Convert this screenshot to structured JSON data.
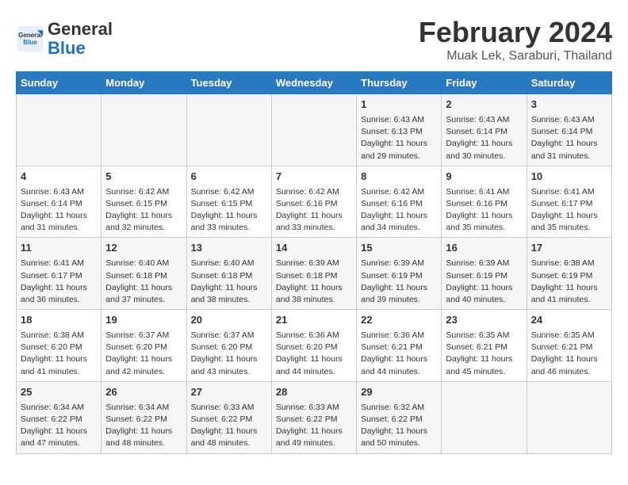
{
  "header": {
    "logo_line1": "General",
    "logo_line2": "Blue",
    "month_year": "February 2024",
    "location": "Muak Lek, Saraburi, Thailand"
  },
  "days_of_week": [
    "Sunday",
    "Monday",
    "Tuesday",
    "Wednesday",
    "Thursday",
    "Friday",
    "Saturday"
  ],
  "weeks": [
    [
      {
        "day": "",
        "info": ""
      },
      {
        "day": "",
        "info": ""
      },
      {
        "day": "",
        "info": ""
      },
      {
        "day": "",
        "info": ""
      },
      {
        "day": "1",
        "info": "Sunrise: 6:43 AM\nSunset: 6:13 PM\nDaylight: 11 hours\nand 29 minutes."
      },
      {
        "day": "2",
        "info": "Sunrise: 6:43 AM\nSunset: 6:14 PM\nDaylight: 11 hours\nand 30 minutes."
      },
      {
        "day": "3",
        "info": "Sunrise: 6:43 AM\nSunset: 6:14 PM\nDaylight: 11 hours\nand 31 minutes."
      }
    ],
    [
      {
        "day": "4",
        "info": "Sunrise: 6:43 AM\nSunset: 6:14 PM\nDaylight: 11 hours\nand 31 minutes."
      },
      {
        "day": "5",
        "info": "Sunrise: 6:42 AM\nSunset: 6:15 PM\nDaylight: 11 hours\nand 32 minutes."
      },
      {
        "day": "6",
        "info": "Sunrise: 6:42 AM\nSunset: 6:15 PM\nDaylight: 11 hours\nand 33 minutes."
      },
      {
        "day": "7",
        "info": "Sunrise: 6:42 AM\nSunset: 6:16 PM\nDaylight: 11 hours\nand 33 minutes."
      },
      {
        "day": "8",
        "info": "Sunrise: 6:42 AM\nSunset: 6:16 PM\nDaylight: 11 hours\nand 34 minutes."
      },
      {
        "day": "9",
        "info": "Sunrise: 6:41 AM\nSunset: 6:16 PM\nDaylight: 11 hours\nand 35 minutes."
      },
      {
        "day": "10",
        "info": "Sunrise: 6:41 AM\nSunset: 6:17 PM\nDaylight: 11 hours\nand 35 minutes."
      }
    ],
    [
      {
        "day": "11",
        "info": "Sunrise: 6:41 AM\nSunset: 6:17 PM\nDaylight: 11 hours\nand 36 minutes."
      },
      {
        "day": "12",
        "info": "Sunrise: 6:40 AM\nSunset: 6:18 PM\nDaylight: 11 hours\nand 37 minutes."
      },
      {
        "day": "13",
        "info": "Sunrise: 6:40 AM\nSunset: 6:18 PM\nDaylight: 11 hours\nand 38 minutes."
      },
      {
        "day": "14",
        "info": "Sunrise: 6:39 AM\nSunset: 6:18 PM\nDaylight: 11 hours\nand 38 minutes."
      },
      {
        "day": "15",
        "info": "Sunrise: 6:39 AM\nSunset: 6:19 PM\nDaylight: 11 hours\nand 39 minutes."
      },
      {
        "day": "16",
        "info": "Sunrise: 6:39 AM\nSunset: 6:19 PM\nDaylight: 11 hours\nand 40 minutes."
      },
      {
        "day": "17",
        "info": "Sunrise: 6:38 AM\nSunset: 6:19 PM\nDaylight: 11 hours\nand 41 minutes."
      }
    ],
    [
      {
        "day": "18",
        "info": "Sunrise: 6:38 AM\nSunset: 6:20 PM\nDaylight: 11 hours\nand 41 minutes."
      },
      {
        "day": "19",
        "info": "Sunrise: 6:37 AM\nSunset: 6:20 PM\nDaylight: 11 hours\nand 42 minutes."
      },
      {
        "day": "20",
        "info": "Sunrise: 6:37 AM\nSunset: 6:20 PM\nDaylight: 11 hours\nand 43 minutes."
      },
      {
        "day": "21",
        "info": "Sunrise: 6:36 AM\nSunset: 6:20 PM\nDaylight: 11 hours\nand 44 minutes."
      },
      {
        "day": "22",
        "info": "Sunrise: 6:36 AM\nSunset: 6:21 PM\nDaylight: 11 hours\nand 44 minutes."
      },
      {
        "day": "23",
        "info": "Sunrise: 6:35 AM\nSunset: 6:21 PM\nDaylight: 11 hours\nand 45 minutes."
      },
      {
        "day": "24",
        "info": "Sunrise: 6:35 AM\nSunset: 6:21 PM\nDaylight: 11 hours\nand 46 minutes."
      }
    ],
    [
      {
        "day": "25",
        "info": "Sunrise: 6:34 AM\nSunset: 6:22 PM\nDaylight: 11 hours\nand 47 minutes."
      },
      {
        "day": "26",
        "info": "Sunrise: 6:34 AM\nSunset: 6:22 PM\nDaylight: 11 hours\nand 48 minutes."
      },
      {
        "day": "27",
        "info": "Sunrise: 6:33 AM\nSunset: 6:22 PM\nDaylight: 11 hours\nand 48 minutes."
      },
      {
        "day": "28",
        "info": "Sunrise: 6:33 AM\nSunset: 6:22 PM\nDaylight: 11 hours\nand 49 minutes."
      },
      {
        "day": "29",
        "info": "Sunrise: 6:32 AM\nSunset: 6:22 PM\nDaylight: 11 hours\nand 50 minutes."
      },
      {
        "day": "",
        "info": ""
      },
      {
        "day": "",
        "info": ""
      }
    ]
  ]
}
